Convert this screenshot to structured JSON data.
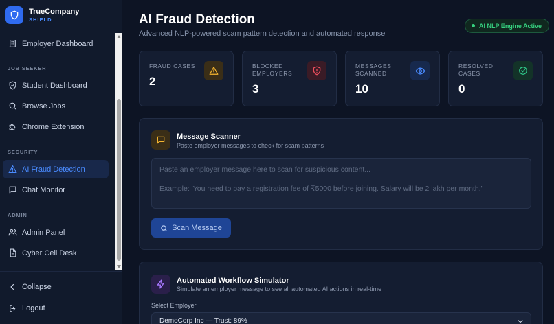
{
  "brand": {
    "name": "TrueCompany",
    "sub": "SHIELD"
  },
  "sidebar": {
    "items": [
      {
        "label": "Employer Dashboard",
        "icon": "building-icon"
      },
      {
        "section": "JOB SEEKER"
      },
      {
        "label": "Student Dashboard",
        "icon": "shield-check-icon"
      },
      {
        "label": "Browse Jobs",
        "icon": "search-icon"
      },
      {
        "label": "Chrome Extension",
        "icon": "puzzle-icon"
      },
      {
        "section": "SECURITY"
      },
      {
        "label": "AI Fraud Detection",
        "icon": "alert-triangle-icon",
        "active": true
      },
      {
        "label": "Chat Monitor",
        "icon": "message-square-icon"
      },
      {
        "section": "ADMIN"
      },
      {
        "label": "Admin Panel",
        "icon": "users-icon"
      },
      {
        "label": "Cyber Cell Desk",
        "icon": "file-text-icon"
      }
    ],
    "bottom": {
      "collapse": "Collapse",
      "logout": "Logout"
    }
  },
  "header": {
    "title": "AI Fraud Detection",
    "subtitle": "Advanced NLP-powered scam pattern detection and automated response",
    "badge": "AI NLP Engine Active"
  },
  "stats": [
    {
      "label": "FRAUD CASES",
      "value": "2",
      "icon": "alert-triangle-icon",
      "color": "#f5b530"
    },
    {
      "label": "BLOCKED EMPLOYERS",
      "value": "3",
      "icon": "shield-alert-icon",
      "color": "#ef4f5e"
    },
    {
      "label": "MESSAGES SCANNED",
      "value": "10",
      "icon": "eye-icon",
      "color": "#4a8bff"
    },
    {
      "label": "RESOLVED CASES",
      "value": "0",
      "icon": "check-circle-icon",
      "color": "#2fc98a"
    }
  ],
  "scanner": {
    "title": "Message Scanner",
    "subtitle": "Paste employer messages to check for scam patterns",
    "placeholder_line1": "Paste an employer message here to scan for suspicious content...",
    "placeholder_line2": "Example: 'You need to pay a registration fee of ₹5000 before joining. Salary will be 2 lakh per month.'",
    "button": "Scan Message"
  },
  "simulator": {
    "title": "Automated Workflow Simulator",
    "subtitle": "Simulate an employer message to see all automated AI actions in real-time",
    "select_label": "Select Employer",
    "select_value": "DemoCorp Inc — Trust: 89%"
  },
  "colors": {
    "accent": "#2f6bf0",
    "active_nav": "#4a8bff",
    "success": "#36d07f",
    "warning": "#f5b530",
    "danger": "#ef4f5e"
  }
}
